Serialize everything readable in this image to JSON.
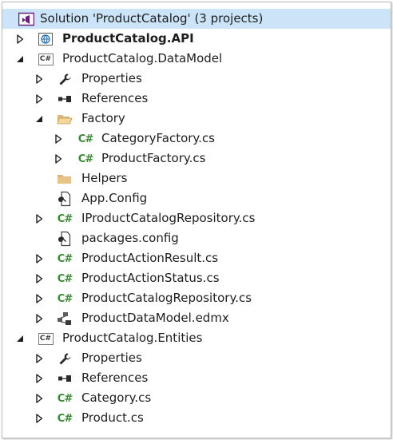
{
  "solution": {
    "label": "Solution 'ProductCatalog' (3 projects)"
  },
  "tree": [
    {
      "label": "ProductCatalog.API",
      "depth": 0,
      "expander": "collapsed",
      "icon": "web-project-icon",
      "bold": true
    },
    {
      "label": "ProductCatalog.DataModel",
      "depth": 0,
      "expander": "expanded",
      "icon": "csharp-project-icon"
    },
    {
      "label": "Properties",
      "depth": 1,
      "expander": "collapsed",
      "icon": "wrench-icon"
    },
    {
      "label": "References",
      "depth": 1,
      "expander": "collapsed",
      "icon": "references-icon"
    },
    {
      "label": "Factory",
      "depth": 1,
      "expander": "expanded",
      "icon": "folder-open-icon"
    },
    {
      "label": "CategoryFactory.cs",
      "depth": 2,
      "expander": "collapsed",
      "icon": "csharp-file-icon"
    },
    {
      "label": "ProductFactory.cs",
      "depth": 2,
      "expander": "collapsed",
      "icon": "csharp-file-icon"
    },
    {
      "label": "Helpers",
      "depth": 1,
      "expander": "none",
      "icon": "folder-icon"
    },
    {
      "label": "App.Config",
      "depth": 1,
      "expander": "none",
      "icon": "config-file-icon"
    },
    {
      "label": "IProductCatalogRepository.cs",
      "depth": 1,
      "expander": "collapsed",
      "icon": "csharp-file-icon"
    },
    {
      "label": "packages.config",
      "depth": 1,
      "expander": "none",
      "icon": "config-file-icon"
    },
    {
      "label": "ProductActionResult.cs",
      "depth": 1,
      "expander": "collapsed",
      "icon": "csharp-file-icon"
    },
    {
      "label": "ProductActionStatus.cs",
      "depth": 1,
      "expander": "collapsed",
      "icon": "csharp-file-icon"
    },
    {
      "label": "ProductCatalogRepository.cs",
      "depth": 1,
      "expander": "collapsed",
      "icon": "csharp-file-icon"
    },
    {
      "label": "ProductDataModel.edmx",
      "depth": 1,
      "expander": "collapsed",
      "icon": "edmx-file-icon"
    },
    {
      "label": "ProductCatalog.Entities",
      "depth": 0,
      "expander": "expanded",
      "icon": "csharp-project-icon"
    },
    {
      "label": "Properties",
      "depth": 1,
      "expander": "collapsed",
      "icon": "wrench-icon"
    },
    {
      "label": "References",
      "depth": 1,
      "expander": "collapsed",
      "icon": "references-icon"
    },
    {
      "label": "Category.cs",
      "depth": 1,
      "expander": "collapsed",
      "icon": "csharp-file-icon"
    },
    {
      "label": "Product.cs",
      "depth": 1,
      "expander": "collapsed",
      "icon": "csharp-file-icon"
    }
  ],
  "icons": {
    "csharp_glyph": "C#",
    "project_glyph": "C#"
  },
  "colors": {
    "selection": "#cce4f7",
    "csharp": "#388a34",
    "folder": "#dcb67a",
    "vs_purple": "#68217a"
  }
}
